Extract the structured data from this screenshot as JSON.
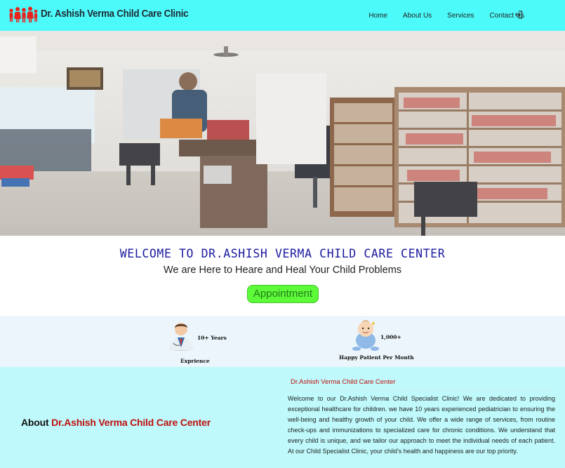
{
  "brand": {
    "name": "Dr. Ashish Verma Child Care Clinic",
    "logo_icon": "children-logo-icon"
  },
  "nav": {
    "items": [
      "Home",
      "About Us",
      "Services",
      "Contact Us"
    ],
    "login_icon": "sign-in-icon"
  },
  "hero": {
    "image": "clinic-interior-photo"
  },
  "welcome": {
    "title": "WELCOME TO DR.ASHISH VERMA CHILD CARE CENTER",
    "subtitle": "We are Here to Heare and Heal Your Child Problems",
    "button": "Appointment"
  },
  "stats": [
    {
      "icon": "doctor-icon",
      "value": "10+ Years",
      "label": "Exprience"
    },
    {
      "icon": "baby-icon",
      "value": "1,000+",
      "label": "Happy Patient Per Month"
    }
  ],
  "about": {
    "heading_prefix": "About",
    "heading_name": "Dr.Ashish Verma Child Care Center",
    "subheading": "Dr.Ashish Verma Child Care Center",
    "body": "Welcome to our Dr.Ashish Verma Child Specialist Clinic! We are dedicated to providing exceptional healthcare for children. we have 10 years experienced pediatrician to ensuring the well-being and healthy growth of your child. We offer a wide range of services, from routine check-ups and immunizations to specialized care for chronic conditions. We understand that every child is unique, and we tailor our approach to meet the individual needs of each patient. At our Child Specialist Clinic, your child's health and happiness are our top priority."
  },
  "colors": {
    "nav_bg": "#4dfafa",
    "accent_red": "#c0100e",
    "title_blue": "#1a1aa0",
    "button_green": "#5dfa3a",
    "about_bg": "#bff9fb"
  }
}
